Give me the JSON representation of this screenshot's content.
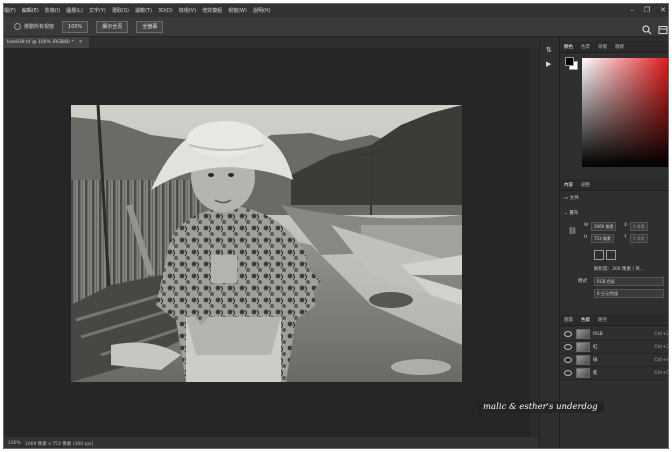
{
  "menubar": {
    "items": [
      "檔(F)",
      "編輯(E)",
      "影像(I)",
      "圖層(L)",
      "文字(Y)",
      "選取(S)",
      "濾鏡(T)",
      "3D(D)",
      "檢視(V)",
      "增效模組",
      "視窗(W)",
      "說明(H)"
    ]
  },
  "options": {
    "scroll_all_label": "捲動所有視窗",
    "zoom_value": "100%",
    "fit_screen_label": "顯示全頁",
    "fill_screen_label": "全螢幕"
  },
  "document": {
    "tab_title": "kids039.tif @ 100% (RGB/8) *",
    "close_glyph": "×"
  },
  "status": {
    "zoom": "100%",
    "info": "1069 像素 x 753 像素 (300 ppi)"
  },
  "color_panel": {
    "tabs": [
      "顏色",
      "色票",
      "漸層",
      "圖樣"
    ],
    "foreground": "#000000",
    "background": "#ffffff",
    "hue": "#e01c1c"
  },
  "properties_panel": {
    "tabs": [
      "內容",
      "調整"
    ],
    "doc_label": "文件",
    "canvas_heading": "畫布",
    "w_label": "W",
    "w_value": "1069 像素",
    "x_label": "X",
    "x_value": "0 像素",
    "h_label": "H",
    "h_value": "753 像素",
    "y_label": "Y",
    "y_value": "0 像素",
    "resolution": "解析度：300 像素 / 英...",
    "mode_label": "模式",
    "mode_value": "RGB 色彩",
    "depth_value": "8 位元/色版"
  },
  "channels_panel": {
    "tabs": [
      "圖層",
      "色版",
      "路徑"
    ],
    "channels": [
      {
        "name": "RGB",
        "key": "Ctrl+2"
      },
      {
        "name": "紅",
        "key": "Ctrl+3"
      },
      {
        "name": "綠",
        "key": "Ctrl+4"
      },
      {
        "name": "藍",
        "key": "Ctrl+5"
      }
    ]
  },
  "watermark": "malic & esther's underdog",
  "icons": [
    "window-minimize-icon",
    "window-restore-icon",
    "window-close-icon",
    "search-icon",
    "workspace-icon",
    "history-icon",
    "play-action-icon",
    "visibility-eye-icon"
  ]
}
